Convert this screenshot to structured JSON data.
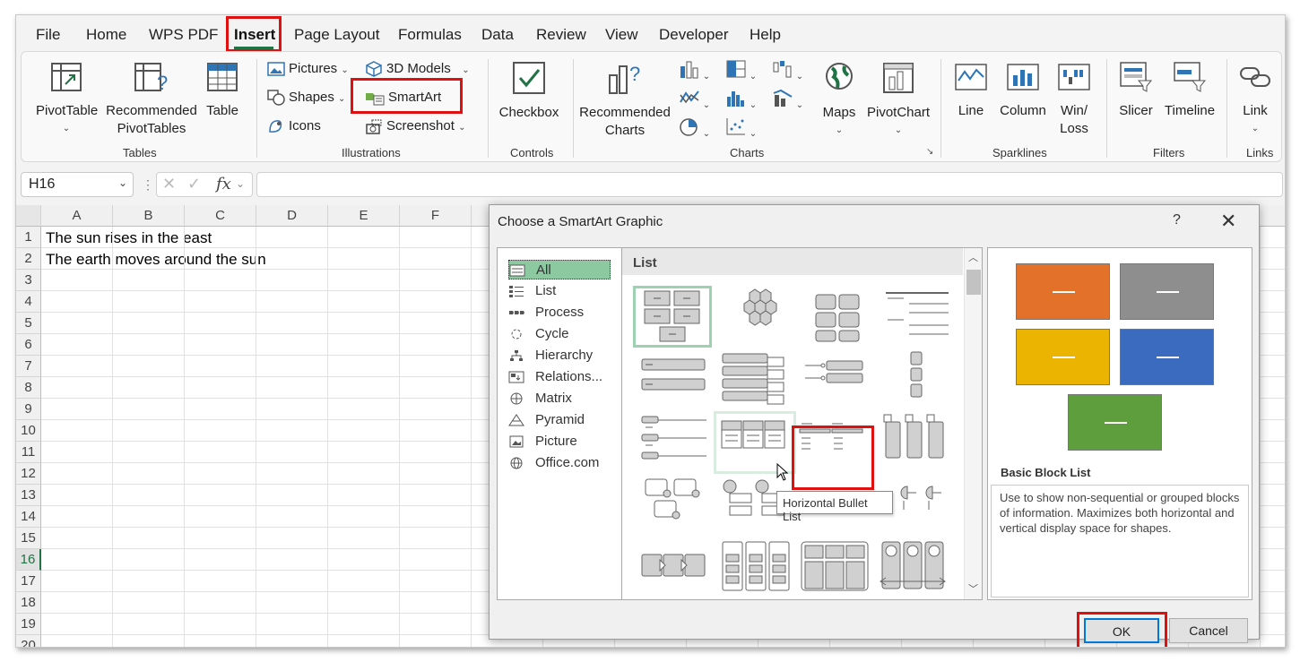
{
  "menu": {
    "items": [
      "File",
      "Home",
      "WPS PDF",
      "Insert",
      "Page Layout",
      "Formulas",
      "Data",
      "Review",
      "View",
      "Developer",
      "Help"
    ],
    "active": "Insert"
  },
  "ribbon": {
    "tables": {
      "pivottable": "PivotTable",
      "recommended_pivottables_1": "Recommended",
      "recommended_pivottables_2": "PivotTables",
      "table": "Table",
      "label": "Tables"
    },
    "illustrations": {
      "pictures": "Pictures",
      "shapes": "Shapes",
      "icons": "Icons",
      "models": "3D Models",
      "smartart": "SmartArt",
      "screenshot": "Screenshot",
      "label": "Illustrations"
    },
    "controls": {
      "checkbox": "Checkbox",
      "label": "Controls"
    },
    "charts": {
      "recommended_1": "Recommended",
      "recommended_2": "Charts",
      "maps": "Maps",
      "pivotchart": "PivotChart",
      "label": "Charts"
    },
    "sparklines": {
      "line": "Line",
      "column": "Column",
      "winloss_1": "Win/",
      "winloss_2": "Loss",
      "label": "Sparklines"
    },
    "filters": {
      "slicer": "Slicer",
      "timeline": "Timeline",
      "label": "Filters"
    },
    "links": {
      "link": "Link",
      "label": "Links"
    }
  },
  "formula_bar": {
    "name_box": "H16",
    "fx": "fx",
    "value": ""
  },
  "sheet": {
    "columns": [
      "A",
      "B",
      "C",
      "D",
      "E",
      "F"
    ],
    "rows": [
      "1",
      "2",
      "3",
      "4",
      "5",
      "6",
      "7",
      "8",
      "9",
      "10",
      "11",
      "12",
      "13",
      "14",
      "15",
      "16",
      "17",
      "18",
      "19",
      "20"
    ],
    "selected_row": "16",
    "cells": {
      "A1": "The sun  rises in the east",
      "A2": "The earth moves around the sun"
    }
  },
  "dialog": {
    "title": "Choose a SmartArt Graphic",
    "help": "?",
    "close": "✕",
    "categories": [
      "All",
      "List",
      "Process",
      "Cycle",
      "Hierarchy",
      "Relations...",
      "Matrix",
      "Pyramid",
      "Picture",
      "Office.com"
    ],
    "selected_category": "All",
    "gallery_header": "List",
    "tooltip": "Horizontal Bullet List",
    "preview_title": "Basic Block List",
    "preview_description": "Use to show non-sequential or grouped blocks of information. Maximizes both horizontal and vertical display space for shapes.",
    "preview_colors": [
      "#e3712a",
      "#8e8e8e",
      "#eab400",
      "#3b6bbf",
      "#5e9e3d"
    ],
    "ok": "OK",
    "cancel": "Cancel"
  }
}
